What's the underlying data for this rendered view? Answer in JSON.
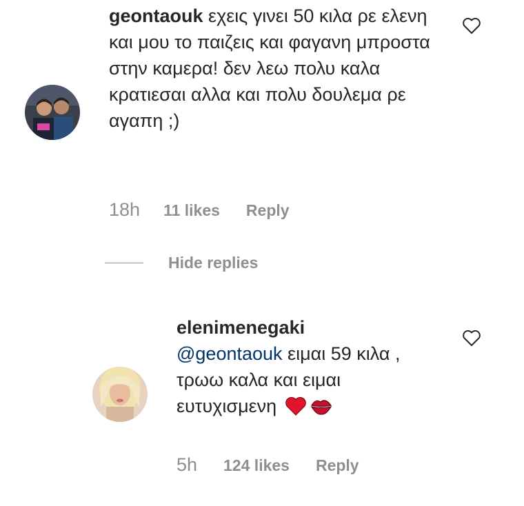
{
  "comment": {
    "username": "geontaouk",
    "text": "εχεις γινει 50 κιλα ρε ελενη και μου το παιζεις και φαγανη μπροστα στην καμερα! δεν λεω πολυ καλα κρατιεσαι αλλα και πολυ δουλεμα ρε αγαπη ;)",
    "time": "18h",
    "likes": "11 likes",
    "reply_label": "Reply"
  },
  "hide_replies_label": "Hide replies",
  "reply": {
    "username": "elenimenegaki",
    "mention": "@geontaouk",
    "text": " ειμαι 59 κιλα , τρωω καλα και ειμαι ευτυχισμενη",
    "emojis": [
      "red-heart-icon",
      "kiss-mark-icon"
    ],
    "time": "5h",
    "likes": "124 likes",
    "reply_label": "Reply"
  },
  "colors": {
    "text": "#262626",
    "muted": "#8e8e8e",
    "mention": "#003569",
    "heart": "#e0142b",
    "kiss": "#c8102e"
  }
}
